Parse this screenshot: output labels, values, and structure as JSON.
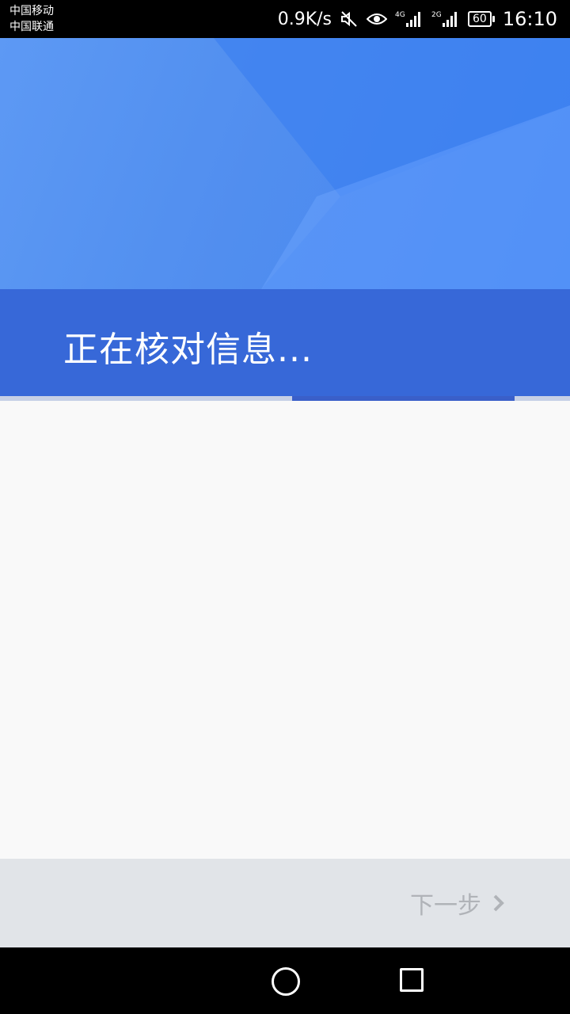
{
  "status_bar": {
    "carrier_1": "中国移动",
    "carrier_2": "中国联通",
    "network_speed": "0.9K/s",
    "signal_1_label": "4G",
    "signal_2_label": "2G",
    "battery_level": "60",
    "time": "16:10",
    "icons": [
      "mute-icon",
      "eye-icon",
      "signal-4g-icon",
      "signal-2g-icon",
      "battery-icon"
    ]
  },
  "header": {
    "title": "正在核对信息..."
  },
  "progress": {
    "value_fraction": 0.39,
    "start_fraction": 0.512
  },
  "footer": {
    "next_label": "下一步",
    "next_icon": "chevron-right-icon"
  },
  "nav_bar": {
    "icons": [
      "home-circle-icon",
      "recent-apps-square-icon"
    ]
  },
  "colors": {
    "header_blue": "#4a8aef",
    "band_blue": "#3768d8",
    "progress_fill": "#3a5fc9",
    "progress_track": "#c6d0e6",
    "content_bg": "#f9f9f9",
    "footer_bg": "#e1e4e8",
    "disabled_text": "#b0b3b8"
  }
}
